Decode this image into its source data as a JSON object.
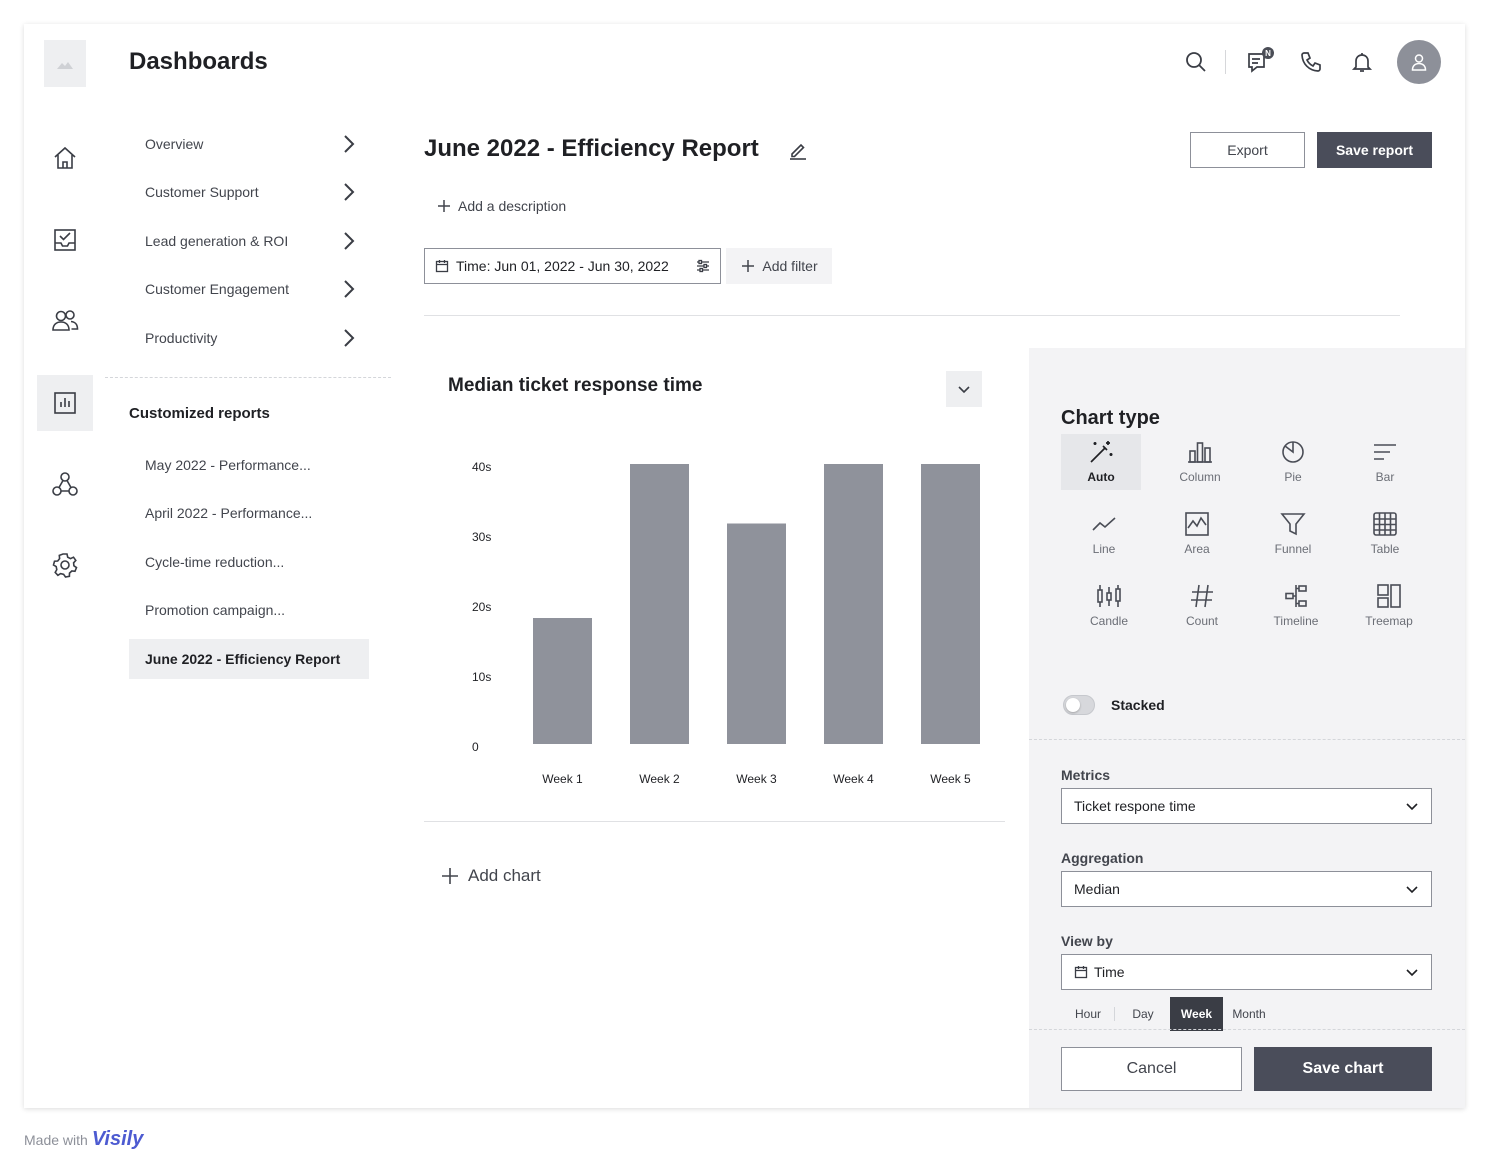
{
  "app": {
    "title": "Dashboards"
  },
  "header": {
    "icons": [
      "search-icon",
      "chat-icon",
      "phone-icon",
      "bell-icon",
      "user-icon"
    ],
    "notification_badge": "N"
  },
  "rail": {
    "items": [
      "home-icon",
      "inbox-icon",
      "users-icon",
      "reports-icon",
      "integrations-icon",
      "settings-icon"
    ],
    "active": "reports-icon"
  },
  "dashboards_nav": [
    {
      "label": "Overview"
    },
    {
      "label": "Customer Support"
    },
    {
      "label": "Lead generation & ROI"
    },
    {
      "label": "Customer Engagement"
    },
    {
      "label": "Productivity"
    }
  ],
  "custom_reports": {
    "title": "Customized reports",
    "items": [
      {
        "label": "May 2022 - Performance..."
      },
      {
        "label": "April 2022 - Performance..."
      },
      {
        "label": "Cycle-time reduction..."
      },
      {
        "label": "Promotion campaign..."
      },
      {
        "label": "June 2022 - Efficiency Report"
      }
    ],
    "active_index": 4
  },
  "report": {
    "title": "June 2022 - Efficiency Report",
    "export_label": "Export",
    "save_label": "Save report",
    "add_description": "Add a description",
    "time_filter": "Time: Jun 01, 2022 - Jun 30, 2022",
    "add_filter": "Add filter",
    "add_chart": "Add chart"
  },
  "chart_data": {
    "type": "bar",
    "title": "Median ticket response time",
    "categories": [
      "Week 1",
      "Week 2",
      "Week 3",
      "Week 4",
      "Week 5"
    ],
    "values": [
      18,
      40,
      31.5,
      40,
      40
    ],
    "ylim": [
      0,
      40
    ],
    "yticks": [
      0,
      10,
      20,
      30,
      40
    ],
    "ytick_labels": [
      "0",
      "10s",
      "20s",
      "30s",
      "40s"
    ],
    "xlabel": "",
    "ylabel": "",
    "bar_color": "#8f929b",
    "grid": false
  },
  "panel": {
    "title": "Chart type",
    "chart_types": [
      {
        "label": "Auto",
        "icon": "magic-wand-icon"
      },
      {
        "label": "Column",
        "icon": "column-chart-icon"
      },
      {
        "label": "Pie",
        "icon": "pie-chart-icon"
      },
      {
        "label": "Bar",
        "icon": "bar-chart-icon"
      },
      {
        "label": "Line",
        "icon": "line-chart-icon"
      },
      {
        "label": "Area",
        "icon": "area-chart-icon"
      },
      {
        "label": "Funnel",
        "icon": "funnel-icon"
      },
      {
        "label": "Table",
        "icon": "table-icon"
      },
      {
        "label": "Candle",
        "icon": "candle-chart-icon"
      },
      {
        "label": "Count",
        "icon": "hash-icon"
      },
      {
        "label": "Timeline",
        "icon": "timeline-icon"
      },
      {
        "label": "Treemap",
        "icon": "treemap-icon"
      }
    ],
    "selected_chart_type": "Auto",
    "stacked_label": "Stacked",
    "stacked_on": false,
    "metrics_label": "Metrics",
    "metrics_value": "Ticket respone time",
    "aggregation_label": "Aggregation",
    "aggregation_value": "Median",
    "viewby_label": "View by",
    "viewby_value": "Time",
    "granularity": [
      "Hour",
      "Day",
      "Week",
      "Month"
    ],
    "granularity_selected": "Week",
    "cancel_label": "Cancel",
    "save_label": "Save chart"
  },
  "footer": {
    "made_with": "Made with",
    "brand": "Visily"
  },
  "colors": {
    "primary_button": "#4a4d5a",
    "panel_bg": "#f3f3f5",
    "bar": "#8f929b",
    "brand": "#4d5bd1"
  }
}
